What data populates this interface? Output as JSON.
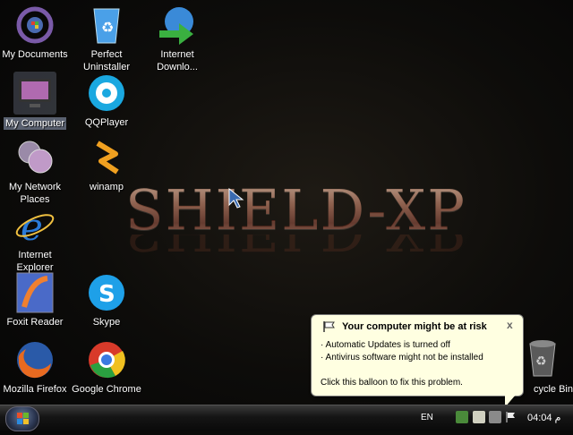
{
  "wallpaper": {
    "title": "SHIELD-XP"
  },
  "icons": [
    {
      "label": "My Documents"
    },
    {
      "label": "Perfect Uninstaller"
    },
    {
      "label": "Internet Downlo..."
    },
    {
      "label": "My Computer"
    },
    {
      "label": "QQPlayer"
    },
    {
      "label": "My Network Places"
    },
    {
      "label": "winamp"
    },
    {
      "label": "Internet Explorer"
    },
    {
      "label": "Foxit Reader"
    },
    {
      "label": "Skype"
    },
    {
      "label": "Mozilla Firefox"
    },
    {
      "label": "Google Chrome"
    },
    {
      "label": "cycle Bin"
    }
  ],
  "balloon": {
    "title": "Your computer might be at risk",
    "close": "x",
    "line1": "· Automatic Updates is turned off",
    "line2": "· Antivirus software might not be installed",
    "line3": "Click this balloon to fix this problem."
  },
  "taskbar": {
    "language": "EN",
    "clock": "04:04 م"
  }
}
